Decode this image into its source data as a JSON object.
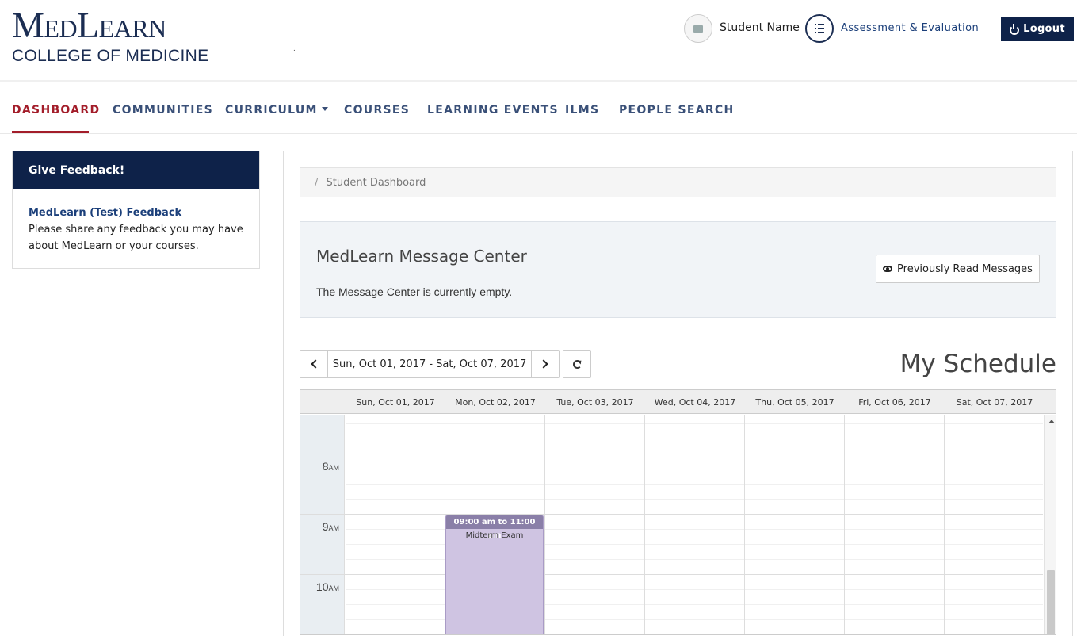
{
  "brand": {
    "name": "MedLearn",
    "subtitle": "COLLEGE OF MEDICINE"
  },
  "header": {
    "user_name": "Student Name",
    "assessment_label": "Assessment & Evaluation",
    "logout_label": "Logout"
  },
  "nav": {
    "items": [
      {
        "label": "DASHBOARD",
        "active": true
      },
      {
        "label": "COMMUNITIES"
      },
      {
        "label": "CURRICULUM"
      },
      {
        "label": "COURSES"
      },
      {
        "label": "LEARNING EVENTS"
      },
      {
        "label": "ILMS"
      },
      {
        "label": "PEOPLE SEARCH"
      }
    ]
  },
  "feedback": {
    "title": "Give Feedback!",
    "link": "MedLearn (Test) Feedback",
    "text": "Please share any feedback you may have about MedLearn or your courses."
  },
  "breadcrumb": {
    "separator": "/",
    "current": "Student Dashboard"
  },
  "message_center": {
    "title": "MedLearn Message Center",
    "empty_text": "The Message Center is currently empty.",
    "prev_button": "Previously Read Messages"
  },
  "schedule": {
    "title": "My Schedule",
    "range": "Sun, Oct 01, 2017 - Sat, Oct 07, 2017",
    "days": [
      "Sun, Oct 01, 2017",
      "Mon, Oct 02, 2017",
      "Tue, Oct 03, 2017",
      "Wed, Oct 04, 2017",
      "Thu, Oct 05, 2017",
      "Fri, Oct 06, 2017",
      "Sat, Oct 07, 2017"
    ],
    "hours": [
      {
        "num": "8",
        "suffix": "AM"
      },
      {
        "num": "9",
        "suffix": "AM"
      },
      {
        "num": "10",
        "suffix": "AM"
      }
    ],
    "event": {
      "time": "09:00 am to 11:00 am",
      "title": "Midterm Exam",
      "color": "#cfc4e2"
    }
  },
  "colors": {
    "brand_navy": "#0e2249",
    "active_red": "#a31d2a"
  }
}
